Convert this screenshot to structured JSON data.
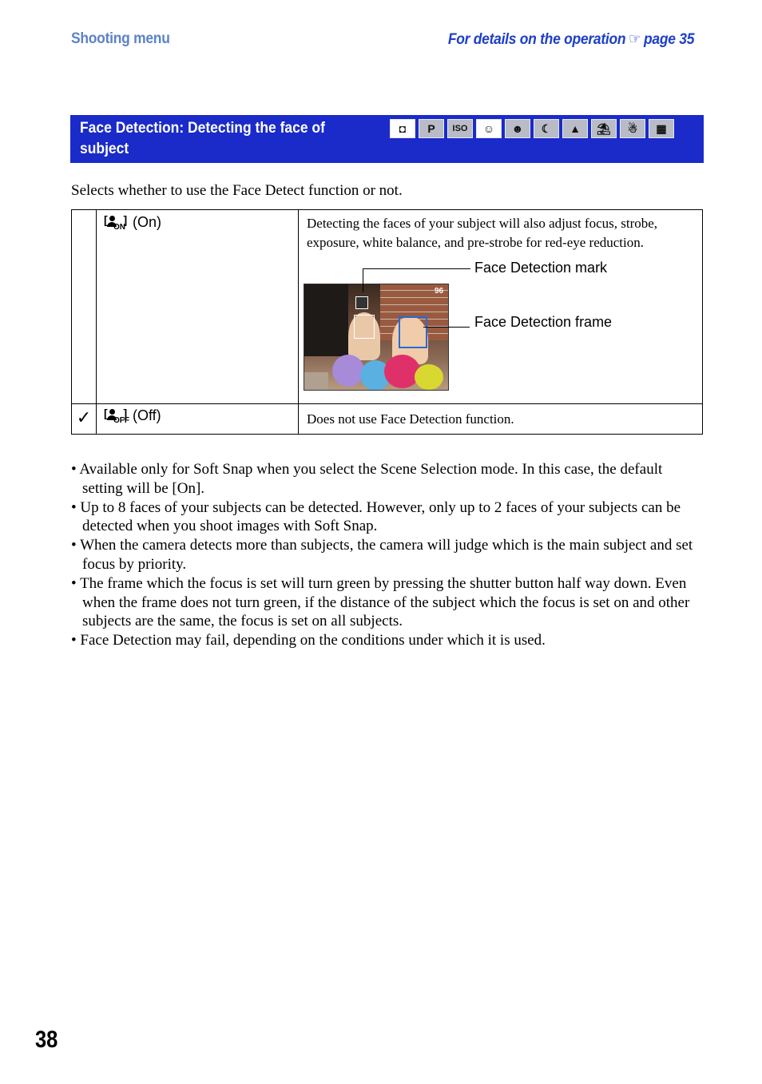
{
  "header": {
    "section": "Shooting menu",
    "reference_prefix": "For details on the operation",
    "reference_icon": "pointing-hand-icon",
    "reference_page": "page 35"
  },
  "title": {
    "text": "Face Detection: Detecting the face of subject",
    "mode_icons": [
      {
        "name": "auto-camera-icon",
        "glyph": "◘",
        "active": true
      },
      {
        "name": "program-icon",
        "glyph": "P",
        "active": false
      },
      {
        "name": "high-sensitivity-iso-icon",
        "glyph": "ISO",
        "active": false
      },
      {
        "name": "soft-snap-icon",
        "glyph": "☺",
        "active": true
      },
      {
        "name": "twilight-portrait-icon",
        "glyph": "☻",
        "active": false
      },
      {
        "name": "twilight-icon",
        "glyph": "☾",
        "active": false
      },
      {
        "name": "landscape-icon",
        "glyph": "▲",
        "active": false
      },
      {
        "name": "beach-icon",
        "glyph": "⛱",
        "active": false
      },
      {
        "name": "snow-icon",
        "glyph": "☃",
        "active": false
      },
      {
        "name": "movie-icon",
        "glyph": "▦",
        "active": false
      }
    ]
  },
  "intro": "Selects whether to use the Face Detect function or not.",
  "options": [
    {
      "default": false,
      "icon_sub": "ON",
      "label": "(On)",
      "description": "Detecting the faces of your subject will also adjust focus, strobe, exposure, white balance, and pre-strobe for red-eye reduction.",
      "callouts": [
        "Face Detection mark",
        "Face Detection frame"
      ],
      "photo_counter": "96"
    },
    {
      "default": true,
      "icon_sub": "OFF",
      "label": "(Off)",
      "description": "Does not use Face Detection function."
    }
  ],
  "notes": [
    "Available only for Soft Snap when you select the Scene Selection mode. In this case, the default setting will be [On].",
    "Up to 8 faces of your subjects can be detected. However, only up to 2 faces of your subjects can be detected when you shoot images with Soft Snap.",
    "When the camera detects more than subjects, the camera will judge which is the main subject and set focus by priority.",
    "The frame which the focus is set will turn green by pressing the shutter button half way down. Even when the frame does not turn green, if the distance of the subject which the focus is set on and other subjects are the same, the focus is set on all subjects.",
    "Face Detection may fail, depending on the conditions under which it is used."
  ],
  "page_number": "38",
  "colors": {
    "header_section": "#5c82c8",
    "header_reference": "#1d3fc8",
    "title_bar": "#1a2bc9"
  }
}
